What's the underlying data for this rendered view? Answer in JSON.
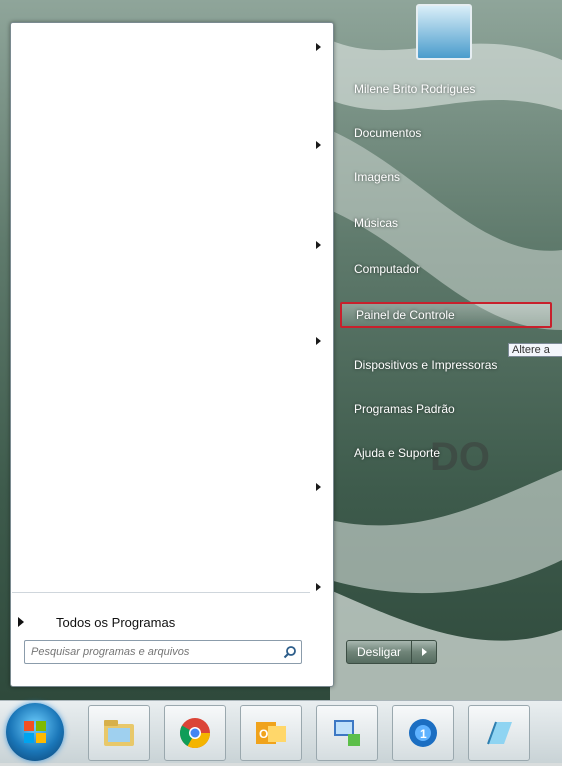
{
  "start_menu": {
    "all_programs_label": "Todos os Programas",
    "search_placeholder": "Pesquisar programas e arquivos",
    "right_items": [
      {
        "label": "Milene Brito Rodrigues"
      },
      {
        "label": "Documentos"
      },
      {
        "label": "Imagens"
      },
      {
        "label": "Músicas"
      },
      {
        "label": "Computador"
      },
      {
        "label": "Painel de Controle"
      },
      {
        "label": "Dispositivos e Impressoras"
      },
      {
        "label": "Programas Padrão"
      },
      {
        "label": "Ajuda e Suporte"
      }
    ],
    "tooltip": "Altere a",
    "shutdown_label": "Desligar"
  },
  "colors": {
    "highlight_border": "#c8202c",
    "taskbar": "#d5dde0"
  },
  "taskbar": {
    "items": [
      {
        "icon": "start-orb-icon"
      },
      {
        "icon": "file-explorer-icon"
      },
      {
        "icon": "chrome-icon"
      },
      {
        "icon": "outlook-icon"
      },
      {
        "icon": "network-icon"
      },
      {
        "icon": "app-icon"
      },
      {
        "icon": "notepad-icon"
      }
    ]
  }
}
